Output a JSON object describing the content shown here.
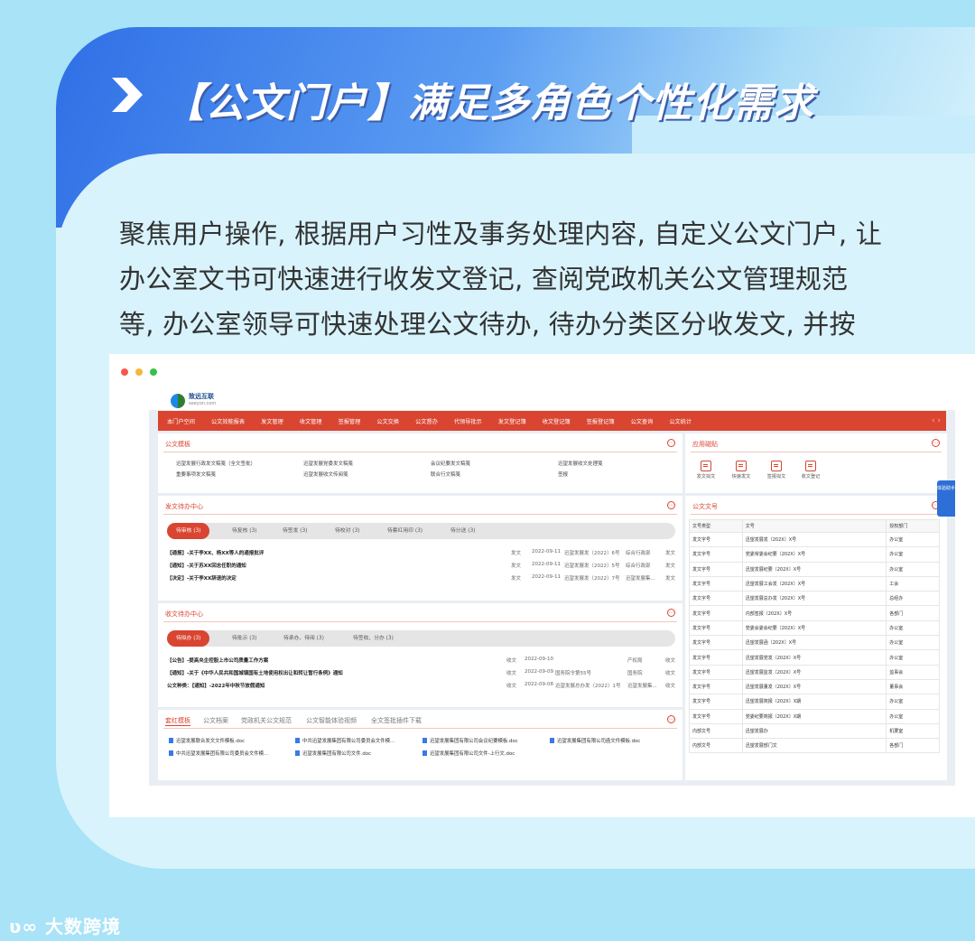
{
  "slide": {
    "title": "【公文门户】满足多角色个性化需求",
    "desc": [
      "聚焦用户操作, 根据用户习性及事务处理内容, 自定义公文门户, 让",
      "办公室文书可快速进行收发文登记, 查阅党政机关公文管理规范",
      "等, 办公室领导可快速处理公文待办, 待办分类区分收发文, 并按"
    ],
    "footer_brand": "大数跨境",
    "footer_logo_mark": "ʋ∞"
  },
  "colors": {
    "accent": "#d94531",
    "banner": "#2f6fe6",
    "bg": "#a8e3f8"
  },
  "app": {
    "logo_text": "致远互联",
    "logo_sub": "seeyon.com",
    "nav": [
      "本门户空间",
      "公文效能报表",
      "发文管理",
      "收文管理",
      "签报管理",
      "公文交换",
      "公文督办",
      "代领导批示",
      "发文登记簿",
      "收文登记簿",
      "签报登记簿",
      "公文查询",
      "公文统计"
    ],
    "nav_arrows": "‹  ›",
    "more_icon": "⋯",
    "float_widget": "体验助手",
    "templates": {
      "title": "公文模板",
      "links": [
        "迅望发展行政发文稿笺（全文签批）",
        "迅望发展党委发文稿笺",
        "会议纪要发文稿笺",
        "迅望发展收文处理笺",
        "重要事项发文稿笺",
        "迅望发展收文传阅笺",
        "联合行文稿笺",
        "签报"
      ]
    },
    "apps": {
      "title": "应用磁贴",
      "items": [
        "发文拟文",
        "快速发文",
        "签报拟文",
        "收文登记"
      ]
    },
    "send_todo": {
      "title": "发文待办中心",
      "tabs": [
        "待审核 (3)",
        "待复核 (3)",
        "待签发 (3)",
        "待校对 (3)",
        "待套红用印 (3)",
        "待分送 (3)"
      ],
      "rows": [
        {
          "title": "【通报】-关于李XX、杨XX等人的通报批评",
          "label": "发文",
          "date": "2022-09-11",
          "doc": "迅望发展发〔2022〕6号",
          "dept": "综合行政部",
          "type": "发文"
        },
        {
          "title": "【通知】-关于苏XX回志任职的通知",
          "label": "发文",
          "date": "2022-09-11",
          "doc": "迅望发展发〔2022〕5号",
          "dept": "综合行政部",
          "type": "发文"
        },
        {
          "title": "【决定】-关于李XX辞退的决定",
          "label": "发文",
          "date": "2022-09-11",
          "doc": "迅望发展发〔2022〕7号",
          "dept": "迅望发展集...",
          "type": "发文"
        }
      ]
    },
    "recv_todo": {
      "title": "收文待办中心",
      "tabs": [
        "待拟办 (3)",
        "待批示 (3)",
        "待承办、待阅 (3)",
        "待签收、分办 (3)"
      ],
      "rows": [
        {
          "title": "【公告】-提高央企控股上市公司质量工作方案",
          "label": "收文",
          "date": "2022-09-10",
          "doc": "",
          "dept": "产权局",
          "type": "收文"
        },
        {
          "title": "【通知】-关于《中华人民共和国城镇国有土地使用权出让和转让暂行条例》通知",
          "label": "收文",
          "date": "2022-09-09",
          "doc": "国务院令第55号",
          "dept": "国务院",
          "type": "收文"
        },
        {
          "title": "公文种类：【通知】-2022年中秋节放假通知",
          "label": "收文",
          "date": "2022-09-08",
          "doc": "迅望发展总办发〔2022〕1号",
          "dept": "迅望发展集...",
          "type": "收文"
        }
      ]
    },
    "doc_numbers": {
      "title": "公文文号",
      "headers": [
        "文号类型",
        "文号",
        "授权部门"
      ],
      "rows": [
        [
          "发文字号",
          "迅望发展发〔202X〕X号",
          "办公室"
        ],
        [
          "发文字号",
          "党委常委会纪要〔202X〕X号",
          "办公室"
        ],
        [
          "发文字号",
          "迅望发展纪要〔202X〕X号",
          "办公室"
        ],
        [
          "发文字号",
          "迅望发展工会发〔202X〕X号",
          "工会"
        ],
        [
          "发文字号",
          "迅望发展总办发〔202X〕X号",
          "总经办"
        ],
        [
          "发文字号",
          "内部签报〔202X〕X号",
          "各部门"
        ],
        [
          "发文字号",
          "党委会委会纪要〔202X〕X号",
          "办公室"
        ],
        [
          "发文字号",
          "迅望发展函〔202X〕X号",
          "办公室"
        ],
        [
          "发文字号",
          "迅望发展党发〔202X〕X号",
          "办公室"
        ],
        [
          "发文字号",
          "迅望发展监发〔202X〕X号",
          "监事会"
        ],
        [
          "发文字号",
          "迅望发展董发〔202X〕X号",
          "董事会"
        ],
        [
          "发文字号",
          "迅望发展简报〔202X〕X期",
          "办公室"
        ],
        [
          "发文字号",
          "党委纪要简报〔202X〕X期",
          "办公室"
        ],
        [
          "内部文号",
          "迅望发展办",
          "机要室"
        ],
        [
          "内部文号",
          "迅望发展部门文",
          "各部门"
        ]
      ]
    },
    "bottom": {
      "tabs": [
        "套红模板",
        "公文档案",
        "党政机关公文规范",
        "公文智能体验视频",
        "全文签批插件下载"
      ],
      "docs": [
        "迅望发展联合发文文件模板.doc",
        "中共迅望发展集团有限公司委员会文件模...",
        "迅望发展集团有限公司会议纪要模板.doc",
        "迅望发展集团有限公司函文件模板.doc",
        "中共迅望发展集团有限公司委员会文件模...",
        "迅望发展集团有限公司文件.doc",
        "迅望发展集团有限公司文件-上行文.doc"
      ]
    }
  }
}
